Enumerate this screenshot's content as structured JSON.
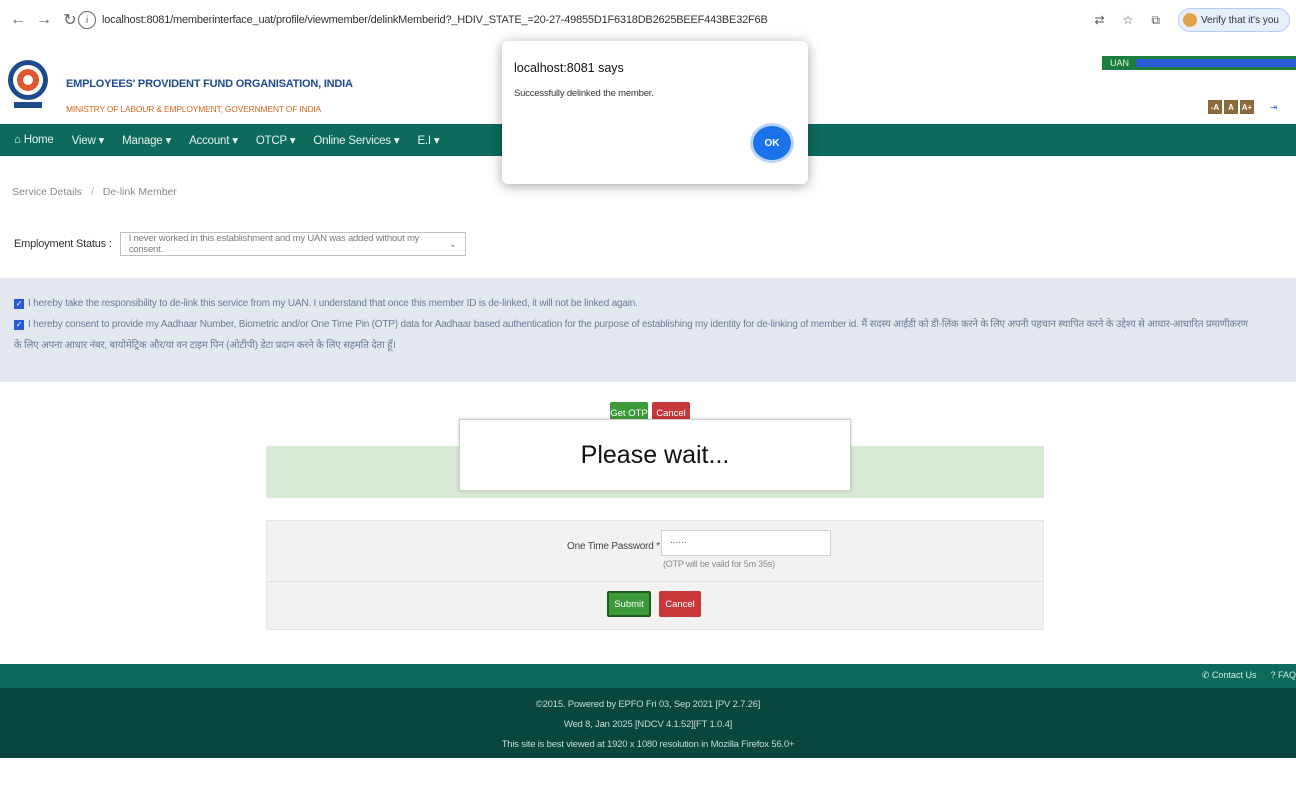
{
  "browser": {
    "url": "localhost:8081/memberinterface_uat/profile/viewmember/delinkMemberid?_HDIV_STATE_=20-27-49855D1F6318DB2625BEEF443BE32F6B",
    "verify_label": "Verify that it's you"
  },
  "header": {
    "org_name": "EMPLOYEES' PROVIDENT FUND ORGANISATION, INDIA",
    "ministry": "MINISTRY OF LABOUR & EMPLOYMENT, GOVERNMENT OF INDIA",
    "uan_label": "UAN",
    "text_size": [
      "-A",
      "A",
      "A+"
    ],
    "logout": "Logout"
  },
  "nav": {
    "items": [
      "Home",
      "View",
      "Manage",
      "Account",
      "OTCP",
      "Online Services",
      "E.I"
    ]
  },
  "breadcrumb": {
    "items": [
      "Service Details",
      "De-link Member"
    ]
  },
  "employment": {
    "label": "Employment Status :",
    "selected": "I never worked in this establishment and my UAN was added without my consent."
  },
  "consent": {
    "line1": "I hereby take the responsibility to de-link this service from my UAN. I understand that once this member ID is de-linked, it will not be linked again.",
    "line2a": "I hereby consent to provide my Aadhaar Number, Biometric and/or One Time Pin (OTP) data for Aadhaar based authentication for the purpose of establishing my identity for de-linking of member id.  मैं सदस्य आईडी को डी-लिंक करने के लिए अपनी पहचान स्थापित करने के उद्देश्य से आधार-आधारित प्रमाणीकरण",
    "line2b": "के लिए अपना आधार नंबर, बायोमेट्रिक और/या वन टाइम पिन (ओटीपी) डेटा प्रदान करने के लिए सहमति देता हूँ।"
  },
  "buttons": {
    "get_otp": "Get OTP",
    "cancel": "Cancel",
    "submit": "Submit"
  },
  "otp": {
    "label": "One Time Password *",
    "value": "......",
    "hint": "(OTP will be valid for 5m 35s)"
  },
  "please_wait": "Please wait...",
  "footer": {
    "contact": "Contact Us",
    "faq": "FAQ",
    "line1": "©2015. Powered by EPFO Fri 03, Sep 2021 [PV 2.7.26]",
    "line2": "Wed 8, Jan 2025 [NDCV 4.1.52][FT 1.0.4]",
    "line3": "This site is best viewed at 1920 x 1080 resolution in Mozilla Firefox 56.0+"
  },
  "dialog": {
    "title": "localhost:8081 says",
    "message": "Successfully delinked the member.",
    "ok": "OK"
  }
}
